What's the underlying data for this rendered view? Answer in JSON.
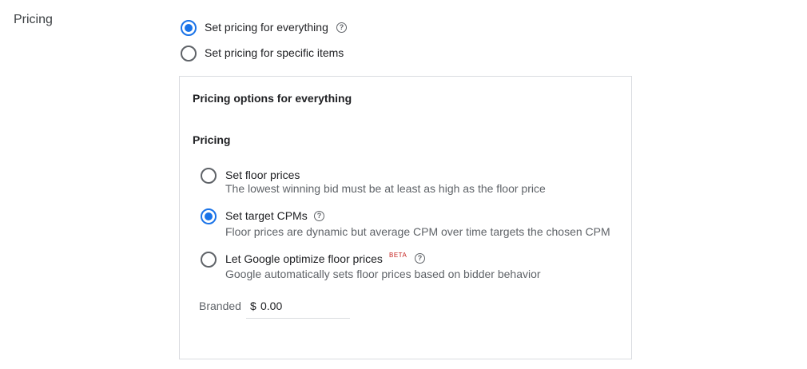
{
  "section_title": "Pricing",
  "scope_options": [
    {
      "label": "Set pricing for everything",
      "selected": true,
      "has_help": true
    },
    {
      "label": "Set pricing for specific items",
      "selected": false,
      "has_help": false
    }
  ],
  "panel": {
    "title": "Pricing options for everything",
    "subtitle": "Pricing",
    "options": [
      {
        "label": "Set floor prices",
        "description": "The lowest winning bid must be at least as high as the floor price",
        "selected": false
      },
      {
        "label": "Set target CPMs",
        "description": "Floor prices are dynamic but average CPM over time targets the chosen CPM",
        "selected": true,
        "help_icon": "help-circle-icon"
      },
      {
        "label": "Let Google optimize floor prices",
        "badge": "BETA",
        "description": "Google automatically sets floor prices based on bidder behavior",
        "selected": false,
        "help_icon": "help-circle-icon"
      }
    ],
    "field": {
      "label": "Branded",
      "currency": "$",
      "value": "0.00"
    }
  },
  "colors": {
    "accent": "#1a73e8",
    "beta": "#c5221f",
    "border": "#dadce0"
  }
}
